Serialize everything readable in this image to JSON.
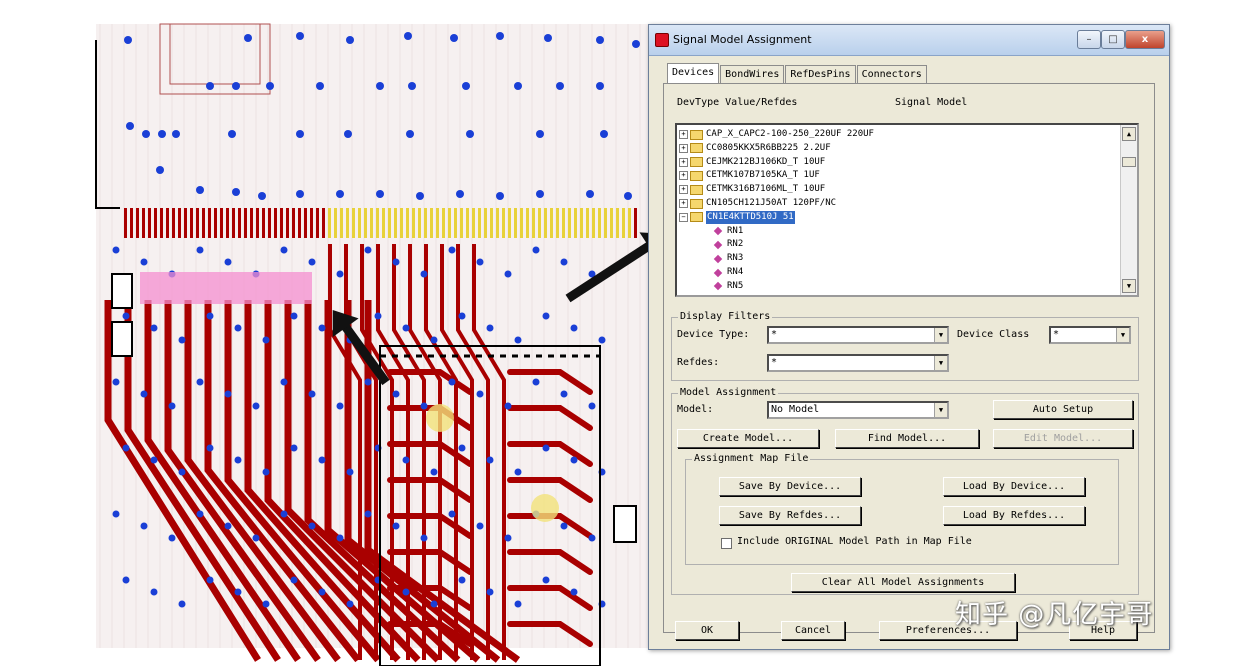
{
  "dialog": {
    "title": "Signal Model Assignment",
    "window_buttons": [
      "–",
      "□",
      "x"
    ],
    "tabs": [
      "Devices",
      "BondWires",
      "RefDesPins",
      "Connectors"
    ],
    "columns": {
      "devtype": "DevType Value/Refdes",
      "signal_model": "Signal Model"
    },
    "tree": [
      {
        "text": "CAP_X_CAPC2-100-250_220UF 220UF",
        "kind": "folder"
      },
      {
        "text": "CC0805KKX5R6BB225 2.2UF",
        "kind": "folder"
      },
      {
        "text": "CEJMK212BJ106KD_T 10UF",
        "kind": "folder"
      },
      {
        "text": "CETMK107B7105KA_T 1UF",
        "kind": "folder"
      },
      {
        "text": "CETMK316B7106ML_T 10UF",
        "kind": "folder"
      },
      {
        "text": "CN105CH121J50AT 120PF/NC",
        "kind": "folder"
      },
      {
        "text": "CN1E4KTTD510J 51",
        "kind": "folder-open",
        "selected": true
      },
      {
        "text": "RN1",
        "kind": "pin"
      },
      {
        "text": "RN2",
        "kind": "pin"
      },
      {
        "text": "RN3",
        "kind": "pin"
      },
      {
        "text": "RN4",
        "kind": "pin"
      },
      {
        "text": "RN5",
        "kind": "pin"
      }
    ],
    "display_filters": {
      "legend": "Display Filters",
      "device_type_label": "Device Type:",
      "device_type_value": "*",
      "device_class_label": "Device Class",
      "device_class_value": "*",
      "refdes_label": "Refdes:",
      "refdes_value": "*"
    },
    "model_assignment": {
      "legend": "Model Assignment",
      "model_label": "Model:",
      "model_value": "No Model",
      "auto_setup": "Auto Setup",
      "create_model": "Create Model...",
      "find_model": "Find Model...",
      "edit_model": "Edit Model..."
    },
    "map_file": {
      "legend": "Assignment Map File",
      "save_by_device": "Save By Device...",
      "load_by_device": "Load By Device...",
      "save_by_refdes": "Save By Refdes...",
      "load_by_refdes": "Load By Refdes...",
      "include_original": "Include ORIGINAL Model Path in Map File"
    },
    "clear_all": "Clear All Model Assignments",
    "footer": {
      "ok": "OK",
      "cancel": "Cancel",
      "preferences": "Preferences...",
      "help": "Help"
    }
  },
  "watermark": "知乎 @凡亿宇哥",
  "colors": {
    "trace": "#a90000",
    "via": "#1a3fd6",
    "selected": "#316ac5",
    "pink_pads": "#f48fd0",
    "yellow_pads": "#e8d23a"
  }
}
